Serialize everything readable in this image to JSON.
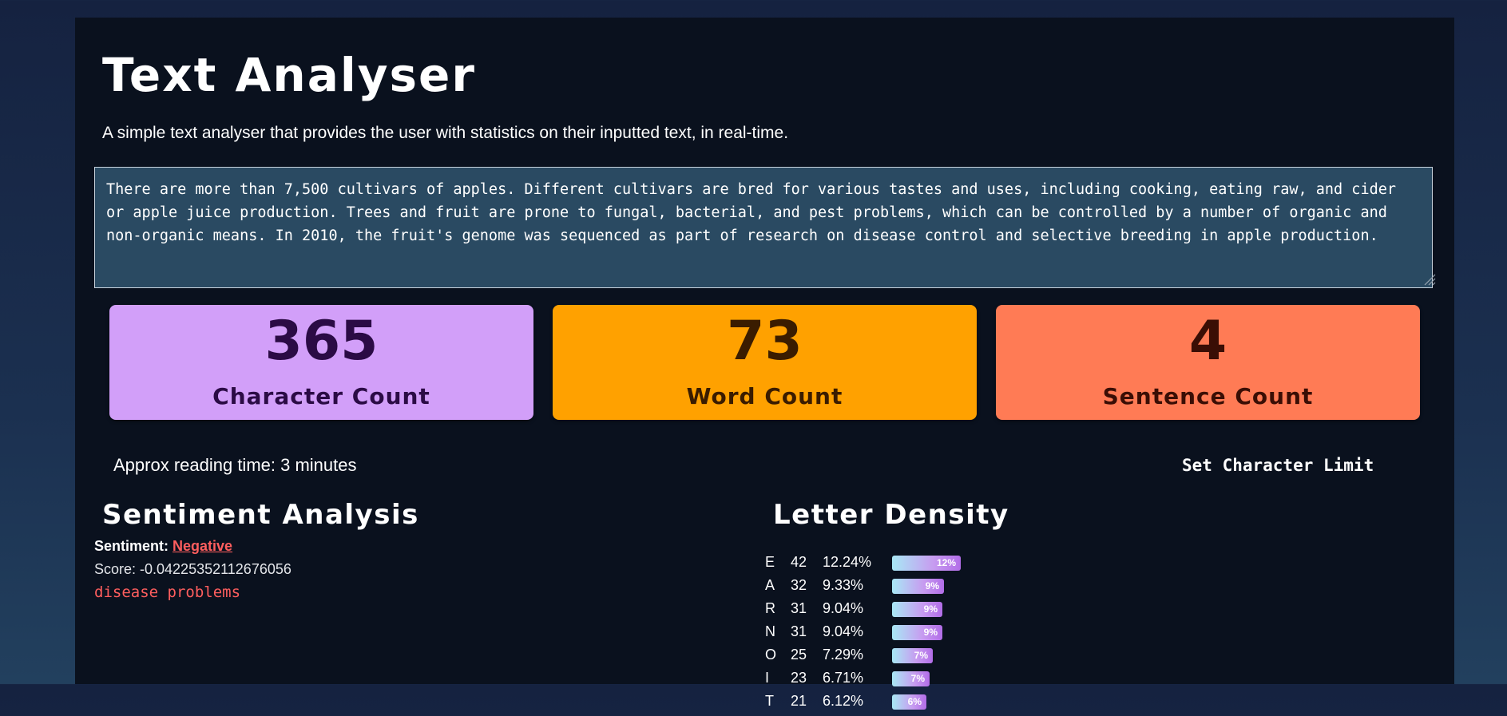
{
  "app": {
    "title": "Text Analyser",
    "subtitle": "A simple text analyser that provides the user with statistics on their inputted text, in real-time."
  },
  "input": {
    "value": "There are more than 7,500 cultivars of apples. Different cultivars are bred for various tastes and uses, including cooking, eating raw, and cider or apple juice production. Trees and fruit are prone to fungal, bacterial, and pest problems, which can be controlled by a number of organic and non-organic means. In 2010, the fruit's genome was sequenced as part of research on disease control and selective breeding in apple production."
  },
  "stats": {
    "characters": {
      "value": "365",
      "label": "Character Count",
      "color": "#d29ff9"
    },
    "words": {
      "value": "73",
      "label": "Word Count",
      "color": "#ffa100"
    },
    "sentences": {
      "value": "4",
      "label": "Sentence Count",
      "color": "#ff7b55"
    }
  },
  "reading_time": "Approx reading time: 3 minutes",
  "set_limit_label": "Set Character Limit",
  "sentiment": {
    "heading": "Sentiment Analysis",
    "label": "Sentiment: ",
    "value": "Negative",
    "score": "Score: -0.04225352112676056",
    "negative_words": "disease problems",
    "negative_color": "#ff5e5e"
  },
  "density": {
    "heading": "Letter Density",
    "rows": [
      {
        "letter": "E",
        "count": "42",
        "percent": "12.24%",
        "bar_label": "12%",
        "bar_fraction": 0.1224
      },
      {
        "letter": "A",
        "count": "32",
        "percent": "9.33%",
        "bar_label": "9%",
        "bar_fraction": 0.0933
      },
      {
        "letter": "R",
        "count": "31",
        "percent": "9.04%",
        "bar_label": "9%",
        "bar_fraction": 0.0904
      },
      {
        "letter": "N",
        "count": "31",
        "percent": "9.04%",
        "bar_label": "9%",
        "bar_fraction": 0.0904
      },
      {
        "letter": "O",
        "count": "25",
        "percent": "7.29%",
        "bar_label": "7%",
        "bar_fraction": 0.0729
      },
      {
        "letter": "I",
        "count": "23",
        "percent": "6.71%",
        "bar_label": "7%",
        "bar_fraction": 0.0671
      },
      {
        "letter": "T",
        "count": "21",
        "percent": "6.12%",
        "bar_label": "6%",
        "bar_fraction": 0.0612
      }
    ]
  }
}
